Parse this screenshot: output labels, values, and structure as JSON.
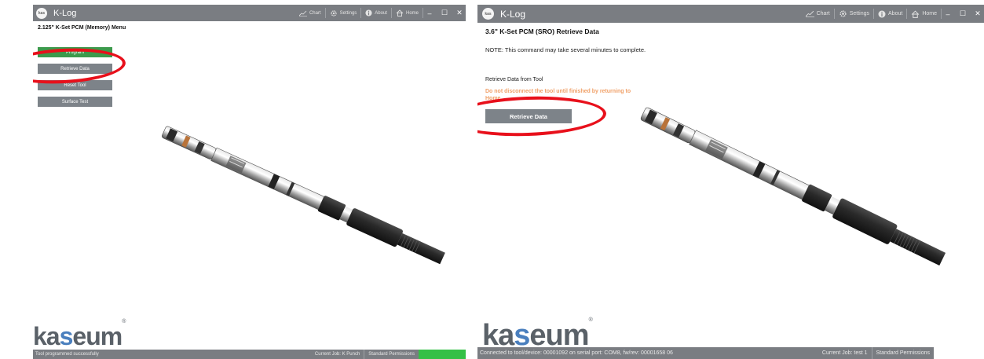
{
  "left": {
    "app_title": "K-Log",
    "logo_text": "kas",
    "nav": {
      "chart": "Chart",
      "settings": "Settings",
      "about": "About",
      "home": "Home"
    },
    "window_controls": {
      "minimize": "–",
      "maximize": "☐",
      "close": "✕"
    },
    "heading": "2.125\" K-Set PCM (Memory) Menu",
    "buttons": [
      "Program",
      "Retrieve Data",
      "Reset Tool",
      "Surface Test"
    ],
    "brand": {
      "prefix": "ka",
      "accent": "s",
      "suffix": "eum",
      "mark": "®"
    },
    "status": {
      "message": "Tool programmed successfully",
      "job": "Current Job: K Punch",
      "permissions": "Standard Permissions",
      "indicator_color": "#35c046"
    }
  },
  "right": {
    "app_title": "K-Log",
    "logo_text": "kas",
    "nav": {
      "chart": "Chart",
      "settings": "Settings",
      "about": "About",
      "home": "Home"
    },
    "window_controls": {
      "minimize": "–",
      "maximize": "☐",
      "close": "✕"
    },
    "heading": "3.6\" K-Set PCM (SRO) Retrieve Data",
    "note": "NOTE: This command may take several minutes to complete.",
    "subheading": "Retrieve Data from Tool",
    "warning": "Do not disconnect the tool until finished by returning to Home.",
    "retrieve_button": "Retrieve Data",
    "brand": {
      "prefix": "ka",
      "accent": "s",
      "suffix": "eum",
      "mark": "®"
    },
    "status": {
      "message": "Connected to tool/device: 00001092 on serial port: COM8, fw/rev: 00001658 06",
      "job": "Current Job: test 1",
      "permissions": "Standard Permissions",
      "indicator_color": "#ffffff"
    }
  },
  "colors": {
    "titlebar": "#7a7d82",
    "button": "#7d8389",
    "program_button": "#3c9a4c",
    "highlight_ellipse": "#e8101b",
    "warning_text": "#f0a068",
    "brand_accent": "#4a7fbe"
  }
}
